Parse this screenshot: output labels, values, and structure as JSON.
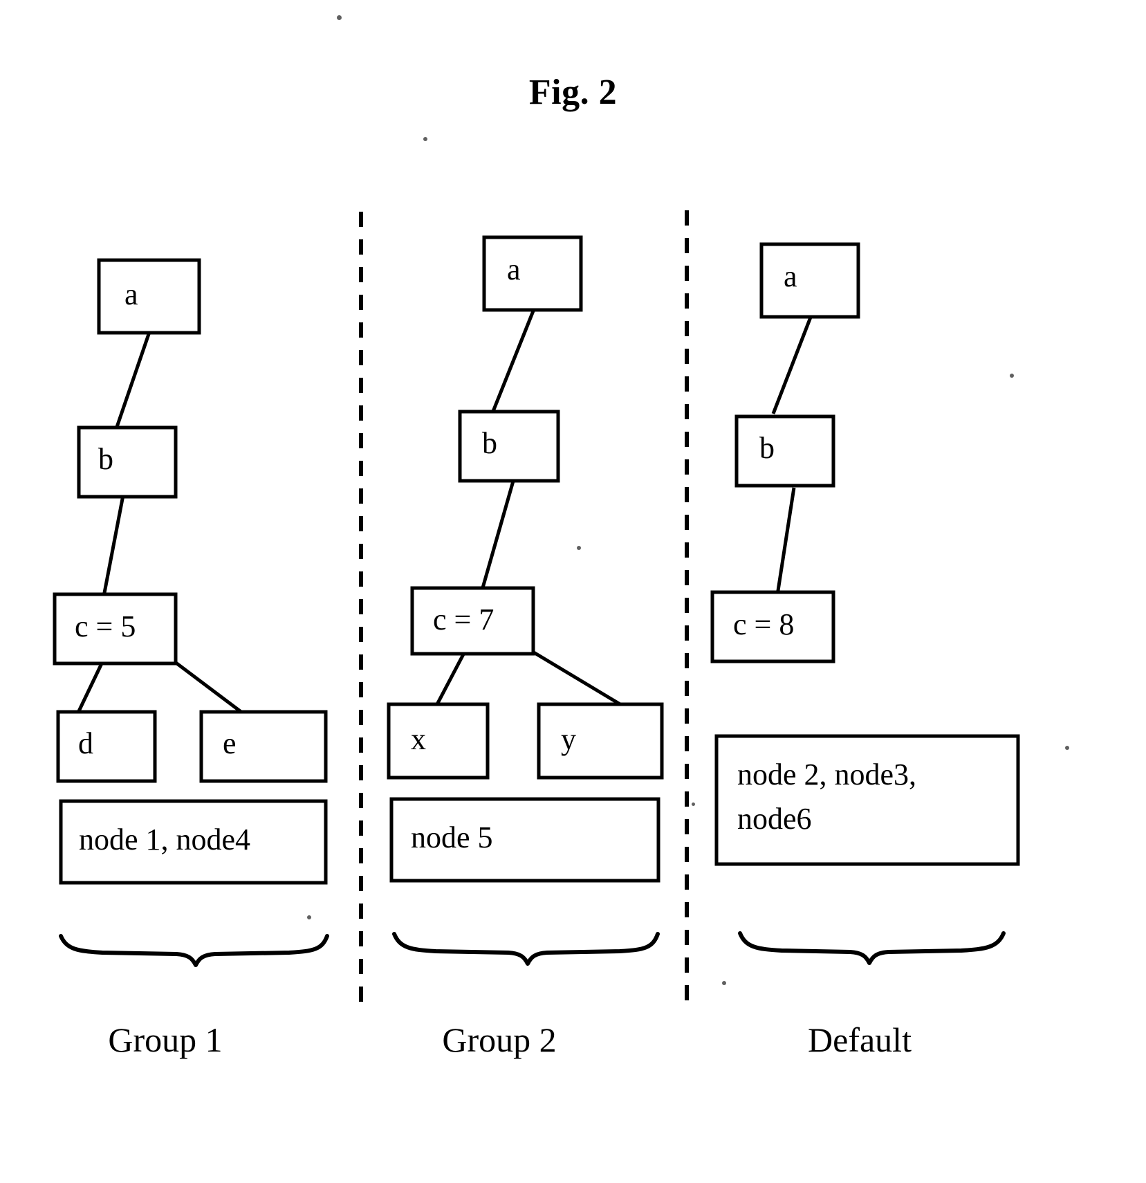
{
  "figure": {
    "title": "Fig. 2"
  },
  "diagram": {
    "type": "tree-group-diagram",
    "columns": [
      {
        "id": "group-1",
        "label": "Group 1",
        "nodes": [
          {
            "id": "g1-a",
            "label": "a"
          },
          {
            "id": "g1-b",
            "label": "b"
          },
          {
            "id": "g1-c",
            "label": "c = 5"
          },
          {
            "id": "g1-d",
            "label": "d"
          },
          {
            "id": "g1-e",
            "label": "e"
          }
        ],
        "edges": [
          {
            "from": "g1-a",
            "to": "g1-b"
          },
          {
            "from": "g1-b",
            "to": "g1-c"
          },
          {
            "from": "g1-c",
            "to": "g1-d"
          },
          {
            "from": "g1-c",
            "to": "g1-e"
          }
        ],
        "node_list": {
          "lines": [
            "node 1, node4"
          ]
        }
      },
      {
        "id": "group-2",
        "label": "Group 2",
        "nodes": [
          {
            "id": "g2-a",
            "label": "a"
          },
          {
            "id": "g2-b",
            "label": "b"
          },
          {
            "id": "g2-c",
            "label": "c = 7"
          },
          {
            "id": "g2-x",
            "label": "x"
          },
          {
            "id": "g2-y",
            "label": "y"
          }
        ],
        "edges": [
          {
            "from": "g2-a",
            "to": "g2-b"
          },
          {
            "from": "g2-b",
            "to": "g2-c"
          },
          {
            "from": "g2-c",
            "to": "g2-x"
          },
          {
            "from": "g2-c",
            "to": "g2-y"
          }
        ],
        "node_list": {
          "lines": [
            "node 5"
          ]
        }
      },
      {
        "id": "default",
        "label": "Default",
        "nodes": [
          {
            "id": "d-a",
            "label": "a"
          },
          {
            "id": "d-b",
            "label": "b"
          },
          {
            "id": "d-c",
            "label": "c = 8"
          }
        ],
        "edges": [
          {
            "from": "d-a",
            "to": "d-b"
          },
          {
            "from": "d-b",
            "to": "d-c"
          }
        ],
        "node_list": {
          "lines": [
            "node 2, node3,",
            "node6"
          ]
        }
      }
    ],
    "dividers": 2,
    "braces": 3,
    "colors": {
      "stroke": "#000000",
      "fill": "#ffffff",
      "background": "#ffffff"
    }
  }
}
